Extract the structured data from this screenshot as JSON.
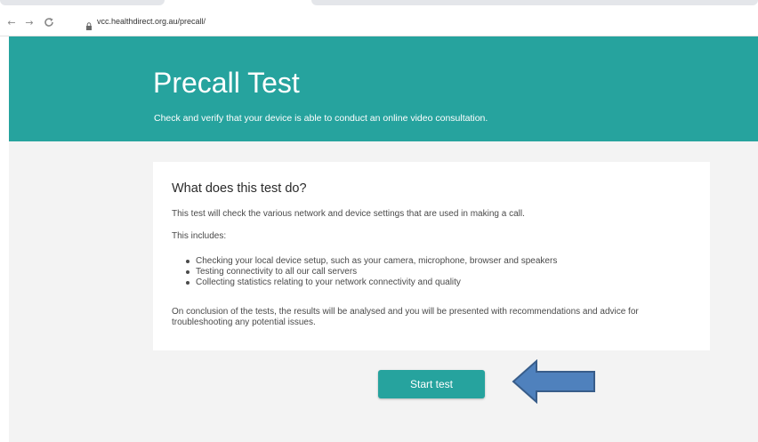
{
  "browser": {
    "url": "vcc.healthdirect.org.au/precall/",
    "icons": [
      "back-arrow-icon",
      "forward-arrow-icon",
      "reload-icon",
      "lock-icon"
    ]
  },
  "hero": {
    "title": "Precall Test",
    "subtitle": "Check and verify that your device is able to conduct an online video consultation."
  },
  "card": {
    "heading": "What does this test do?",
    "intro": "This test will check the various network and device settings that are used in making a call.",
    "includes_label": "This includes:",
    "items": [
      "Checking your local device setup, such as your camera, microphone, browser and speakers",
      "Testing connectivity to all our call servers",
      "Collecting statistics relating to your network connectivity and quality"
    ],
    "conclusion": "On conclusion of the tests, the results will be analysed and you will be presented with recommendations and advice for troubleshooting any potential issues."
  },
  "actions": {
    "start_label": "Start test"
  },
  "colors": {
    "brand_teal": "#26a39e",
    "page_bg": "#f3f3f3",
    "arrow_fill": "#4f81bd",
    "arrow_stroke": "#385d8a"
  }
}
